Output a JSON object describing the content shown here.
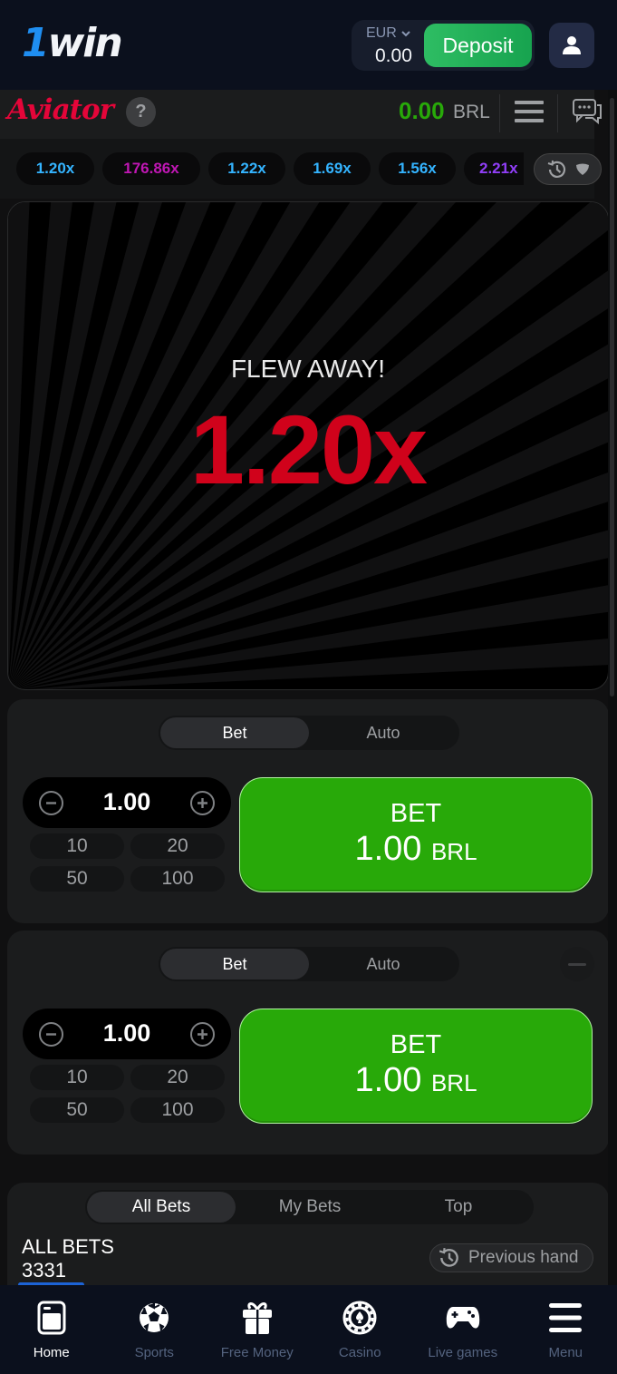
{
  "site": {
    "logo_one": "1",
    "logo_win": "win",
    "wallet_currency": "EUR",
    "wallet_balance": "0.00",
    "deposit_label": "Deposit"
  },
  "game": {
    "title": "Aviator",
    "help_label": "?",
    "balance": "0.00",
    "balance_currency": "BRL"
  },
  "history": [
    {
      "value": "1.20x",
      "color": "#34b4ff"
    },
    {
      "value": "176.86x",
      "color": "#c017b4"
    },
    {
      "value": "1.22x",
      "color": "#34b4ff"
    },
    {
      "value": "1.69x",
      "color": "#34b4ff"
    },
    {
      "value": "1.56x",
      "color": "#34b4ff"
    },
    {
      "value": "2.21x",
      "color": "#913ef8"
    }
  ],
  "stage": {
    "status": "FLEW AWAY!",
    "multiplier": "1.20x"
  },
  "bet_panels": [
    {
      "tabs": [
        "Bet",
        "Auto"
      ],
      "active_tab": "Bet",
      "amount": "1.00",
      "quick": [
        "10",
        "20",
        "50",
        "100"
      ],
      "button_label": "BET",
      "button_amount": "1.00",
      "button_currency": "BRL"
    },
    {
      "tabs": [
        "Bet",
        "Auto"
      ],
      "active_tab": "Bet",
      "amount": "1.00",
      "quick": [
        "10",
        "20",
        "50",
        "100"
      ],
      "button_label": "BET",
      "button_amount": "1.00",
      "button_currency": "BRL"
    }
  ],
  "bets": {
    "tabs": [
      "All Bets",
      "My Bets",
      "Top"
    ],
    "active_tab": "All Bets",
    "title": "ALL BETS",
    "count": "3331",
    "previous_hand_label": "Previous hand"
  },
  "bottom_nav": [
    {
      "label": "Home",
      "icon": "home-icon",
      "active": true
    },
    {
      "label": "Sports",
      "icon": "soccer-ball-icon",
      "active": false
    },
    {
      "label": "Free Money",
      "icon": "gift-icon",
      "active": false
    },
    {
      "label": "Casino",
      "icon": "casino-chip-icon",
      "active": false
    },
    {
      "label": "Live games",
      "icon": "gamepad-icon",
      "active": false
    },
    {
      "label": "Menu",
      "icon": "menu-icon",
      "active": false
    }
  ]
}
